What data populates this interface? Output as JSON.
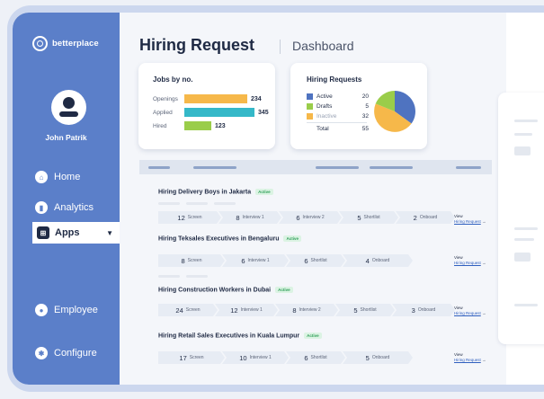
{
  "brand": {
    "name": "betterplace"
  },
  "user": {
    "name": "John Patrik"
  },
  "nav": {
    "home": "Home",
    "analytics": "Analytics",
    "apps": "Apps",
    "employee": "Employee",
    "configure": "Configure"
  },
  "header": {
    "title": "Hiring Request",
    "subtitle": "Dashboard"
  },
  "jobs_card": {
    "title": "Jobs by no.",
    "rows": [
      {
        "label": "Openings",
        "value": "234",
        "color": "#f6b84a"
      },
      {
        "label": "Applied",
        "value": "345",
        "color": "#35b8c8"
      },
      {
        "label": "Hired",
        "value": "123",
        "color": "#9acd4a"
      }
    ]
  },
  "requests_card": {
    "title": "Hiring Requests",
    "rows": [
      {
        "label": "Active",
        "value": "20",
        "color": "#4f73c0"
      },
      {
        "label": "Drafts",
        "value": "5",
        "color": "#9acd4a"
      },
      {
        "label": "Inactive",
        "value": "32",
        "color": "#f6b84a"
      }
    ],
    "total_label": "Total",
    "total_value": "55"
  },
  "jobs": [
    {
      "title": "Hiring Delivery Boys in Jakarta",
      "status": "Active",
      "stages": [
        {
          "n": "12",
          "label": "Screen"
        },
        {
          "n": "8",
          "label": "Interview 1"
        },
        {
          "n": "6",
          "label": "Interview 2"
        },
        {
          "n": "5",
          "label": "Shortlist"
        },
        {
          "n": "2",
          "label": "Onboard"
        }
      ],
      "view": "View",
      "link": "Hiring Request"
    },
    {
      "title": "Hiring Teksales Executives in Bengaluru",
      "status": "Active",
      "stages": [
        {
          "n": "8",
          "label": "Screen"
        },
        {
          "n": "6",
          "label": "Interview 1"
        },
        {
          "n": "6",
          "label": "Shortlist"
        },
        {
          "n": "4",
          "label": "Onboard"
        }
      ],
      "view": "View",
      "link": "Hiring Request"
    },
    {
      "title": "Hiring Construction Workers in Dubai",
      "status": "Active",
      "stages": [
        {
          "n": "24",
          "label": "Screen"
        },
        {
          "n": "12",
          "label": "Interview 1"
        },
        {
          "n": "8",
          "label": "Interview 2"
        },
        {
          "n": "5",
          "label": "Shortlist"
        },
        {
          "n": "3",
          "label": "Onboard"
        }
      ],
      "view": "View",
      "link": "Hiring Request"
    },
    {
      "title": "Hiring Retail Sales Executives in Kuala Lumpur",
      "status": "Active",
      "stages": [
        {
          "n": "17",
          "label": "Screen"
        },
        {
          "n": "10",
          "label": "Interview 1"
        },
        {
          "n": "6",
          "label": "Shortlist"
        },
        {
          "n": "5",
          "label": "Onboard"
        }
      ],
      "view": "View",
      "link": "Hiring Request"
    }
  ],
  "icons": {
    "home": "home-icon",
    "analytics": "analytics-icon",
    "apps": "apps-grid-icon",
    "employee": "employee-icon",
    "configure": "gear-icon"
  }
}
